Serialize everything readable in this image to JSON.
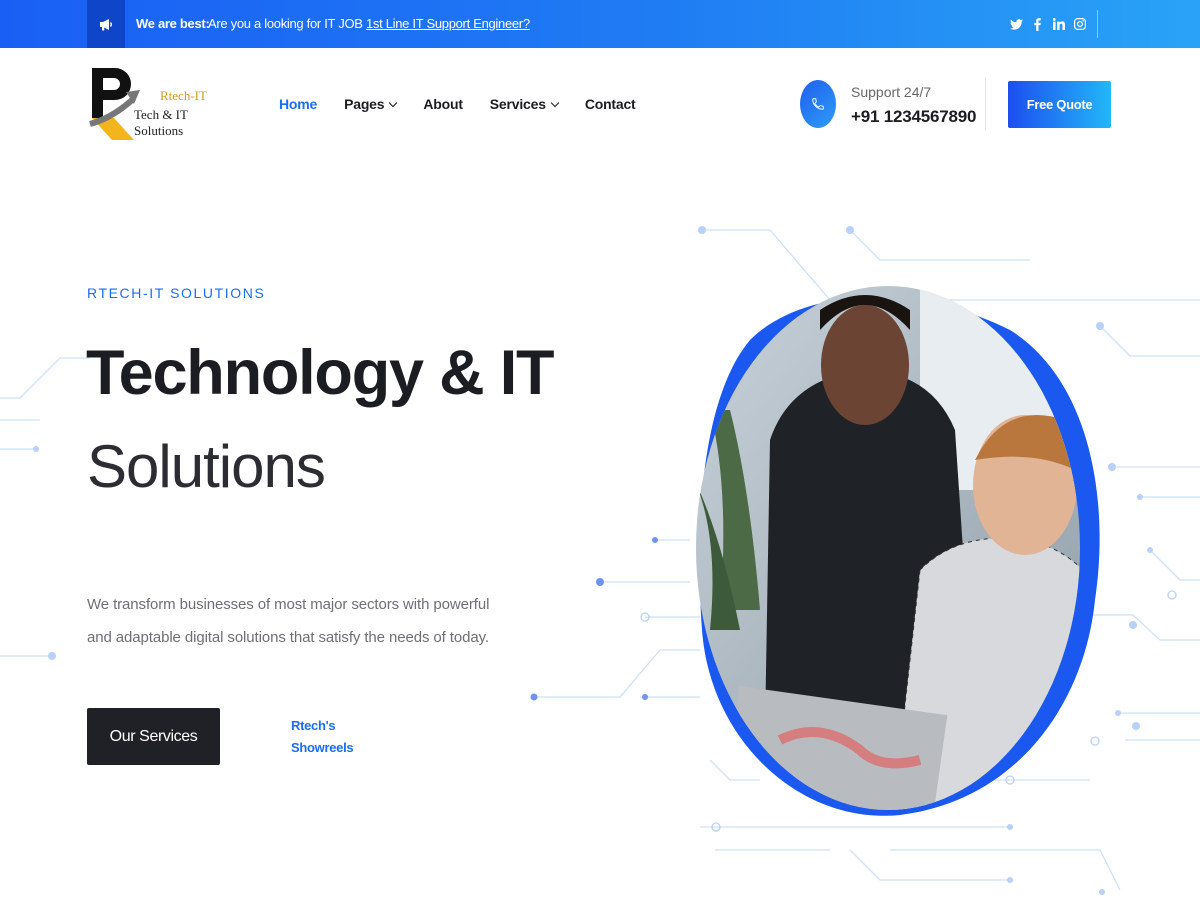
{
  "topbar": {
    "announce_label": "We are best:",
    "message_text": "Are you a looking for IT JOB ",
    "message_link": "1st Line IT Support Engineer?",
    "social_icons": [
      "twitter-icon",
      "facebook-icon",
      "linkedin-icon",
      "instagram-icon"
    ]
  },
  "logo": {
    "brand": "Rtech-IT",
    "tagline": "Tech & IT Solutions"
  },
  "nav": {
    "items": [
      {
        "label": "Home",
        "active": true
      },
      {
        "label": "Pages",
        "dropdown": true
      },
      {
        "label": "About"
      },
      {
        "label": "Services",
        "dropdown": true
      },
      {
        "label": "Contact"
      }
    ]
  },
  "support": {
    "label": "Support 24/7",
    "phone": "+91 1234567890"
  },
  "cta": {
    "quote_label": "Free Quote"
  },
  "hero": {
    "eyebrow": "RTECH-IT SOLUTIONS",
    "title_line1": "Technology & IT",
    "title_line2": "Solutions",
    "description": "We transform businesses of most major sectors with powerful and adaptable digital solutions that satisfy the needs of today.",
    "primary_button": "Our Services",
    "secondary_link": "Rtech's Showreels"
  },
  "colors": {
    "accent": "#1a6ef5",
    "dark": "#202126",
    "topbar_start": "#1a5ff5",
    "topbar_end": "#29a3f7"
  }
}
